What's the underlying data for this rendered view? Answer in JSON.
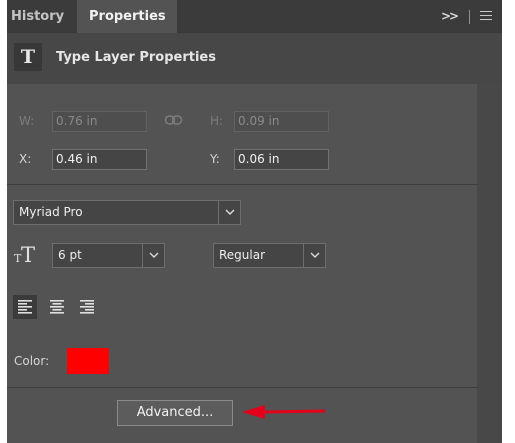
{
  "tabs": [
    {
      "label": "History",
      "active": false
    },
    {
      "label": "Properties",
      "active": true
    }
  ],
  "tab_controls": {
    "expand_icon": "double-chevron-right-icon",
    "expand_glyph": ">>",
    "menu_icon": "hamburger-menu-icon"
  },
  "header": {
    "icon": "type-layer-icon",
    "icon_glyph": "T",
    "title": "Type Layer Properties"
  },
  "transform": {
    "w_label": "W:",
    "w_value": "0.76 in",
    "link_icon": "chain-link-icon",
    "h_label": "H:",
    "h_value": "0.09 in",
    "x_label": "X:",
    "x_value": "0.46 in",
    "y_label": "Y:",
    "y_value": "0.06 in"
  },
  "character": {
    "font_family": "Myriad Pro",
    "font_size_icon": "font-size-icon",
    "font_size": "6 pt",
    "font_style": "Regular"
  },
  "paragraph": {
    "alignment_buttons": [
      "align-left-icon",
      "align-center-icon",
      "align-right-icon"
    ],
    "active_alignment": "left"
  },
  "color": {
    "label": "Color:",
    "value": "#ff0000"
  },
  "advanced_button": {
    "label": "Advanced..."
  },
  "annotation": {
    "arrow_color": "#e2001a"
  },
  "colors": {
    "panel_bg": "#535353",
    "tab_bar_bg": "#3b3b3b",
    "header_bg": "#474747"
  }
}
